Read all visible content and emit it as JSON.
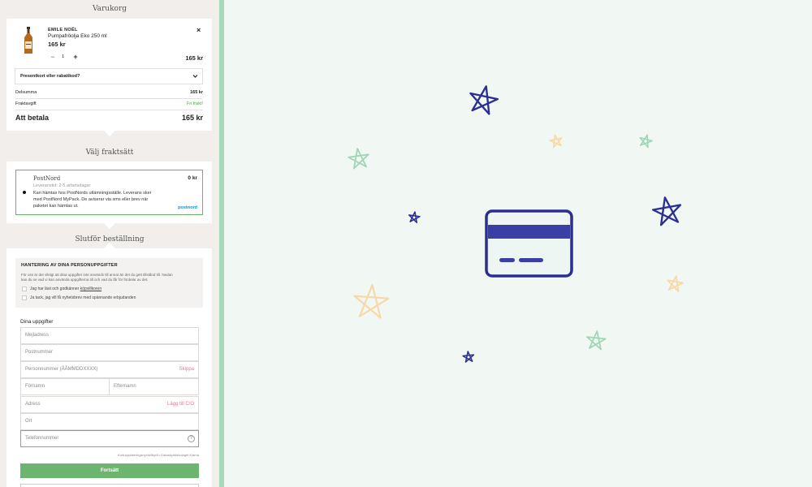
{
  "cart": {
    "title": "Varukorg",
    "item": {
      "brand": "EMILE NOËL",
      "name": "Pumpafröolja Eko 250 ml",
      "price": "165 kr",
      "quantity": "1",
      "minus": "−",
      "plus": "+",
      "line_total": "165 kr",
      "remove": "×"
    },
    "coupon_label": "Presentkort eller rabattkod?",
    "subtotal_label": "Delsumma",
    "subtotal_value": "165 kr",
    "shipping_label": "Fraktavgift",
    "shipping_value": "Fri frakt!",
    "total_label": "Att betala",
    "total_value": "165 kr"
  },
  "shipping": {
    "title": "Välj fraktsätt",
    "option": {
      "name": "PostNord",
      "price": "0 kr",
      "delivery_time": "Leveranstid: 2-5 arbetsdagar",
      "description_line1": "Kan hämtas hos PostNords utlämningsställe. Leverans sker",
      "description_line2": "med PostNord MyPack. De aviserar via sms eller brev när",
      "description_line3": "paketet kan hämtas ut.",
      "logo": "postnord"
    }
  },
  "complete": {
    "title": "Slutför beställning",
    "gdpr_heading": "HANTERING AV DINA PERSONUPPGIFTER",
    "gdpr_text_line1": "För oss är det viktigt att dina uppgifter inte används till annat än det du gett tillstånd till. Nedan",
    "gdpr_text_line2": "kan du se vad vi kan använda uppgifterna till och vad du får för fördelar av det.",
    "terms_prefix": "Jag har läst och godkänner ",
    "terms_link": "köpvillkoren",
    "newsletter": "Ja tack, jag vill få nyhetsbrev med spännande erbjudanden",
    "details_heading": "Dina uppgifter",
    "email_placeholder": "Mejladress",
    "zip_placeholder": "Postnummer",
    "ssn_placeholder": "Personnummer (ÅÅMMDDXXXX)",
    "ssn_skip": "Skippa",
    "firstname_placeholder": "Förnamn",
    "lastname_placeholder": "Efternamn",
    "address_placeholder": "Adress",
    "address_co": "Lägg till C/O",
    "city_placeholder": "Ort",
    "phone_placeholder": "Telefonnummer",
    "phone_help": "?",
    "klarna_note": "Kortuppdateringsnyckelbyrå • Dataskyddsbolaget Klarna",
    "continue_button": "Fortsätt"
  },
  "colors": {
    "accent_green": "#6db56f",
    "card_navy": "#2b2f93",
    "card_band": "#3a3fa8",
    "link_pink": "#e3739a",
    "postnord_blue": "#1a8fc8",
    "divider_green": "#a6d8bb"
  },
  "illustration": {
    "icon": "credit-card-icon",
    "decorations": "star-icons"
  }
}
